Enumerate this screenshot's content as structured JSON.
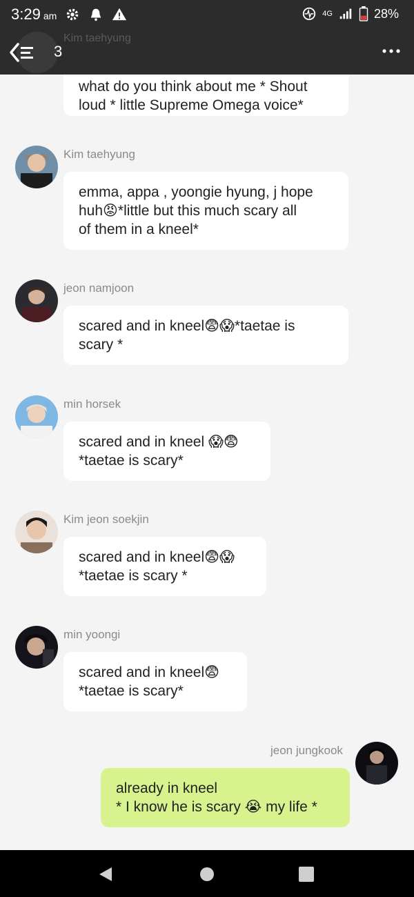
{
  "status_bar": {
    "time": "3:29",
    "ampm": "am",
    "network": "4G",
    "battery": "28%"
  },
  "header": {
    "count": "3",
    "top_partial_name": "Kim taehyung"
  },
  "messages": [
    {
      "sender": "Kim taehyung",
      "text": "what do you think about me * Shout\nloud * little Supreme Omega voice*"
    },
    {
      "sender": "Kim taehyung",
      "text": "emma, appa , yoongie hyung, j hope\nhuh😡*little but this much scary all\nof them in a kneel*"
    },
    {
      "sender": "jeon namjoon",
      "text": "scared and in kneel😨😱*taetae is\nscary *"
    },
    {
      "sender": "min horsek",
      "text": "scared and in kneel 😱😨\n*taetae is scary*"
    },
    {
      "sender": "Kim jeon soekjin",
      "text": "scared and in kneel😨😱\n*taetae is scary *"
    },
    {
      "sender": "min yoongi",
      "text": "scared and in kneel😨\n*taetae is scary*"
    },
    {
      "sender": "jeon jungkook",
      "text": "already in kneel\n* I know he is scary 😭 my life *"
    }
  ],
  "colors": {
    "bar": "#2c2c2c",
    "bubble": "#ffffff",
    "my_bubble": "#d8f28e",
    "background": "#f4f4f4"
  }
}
